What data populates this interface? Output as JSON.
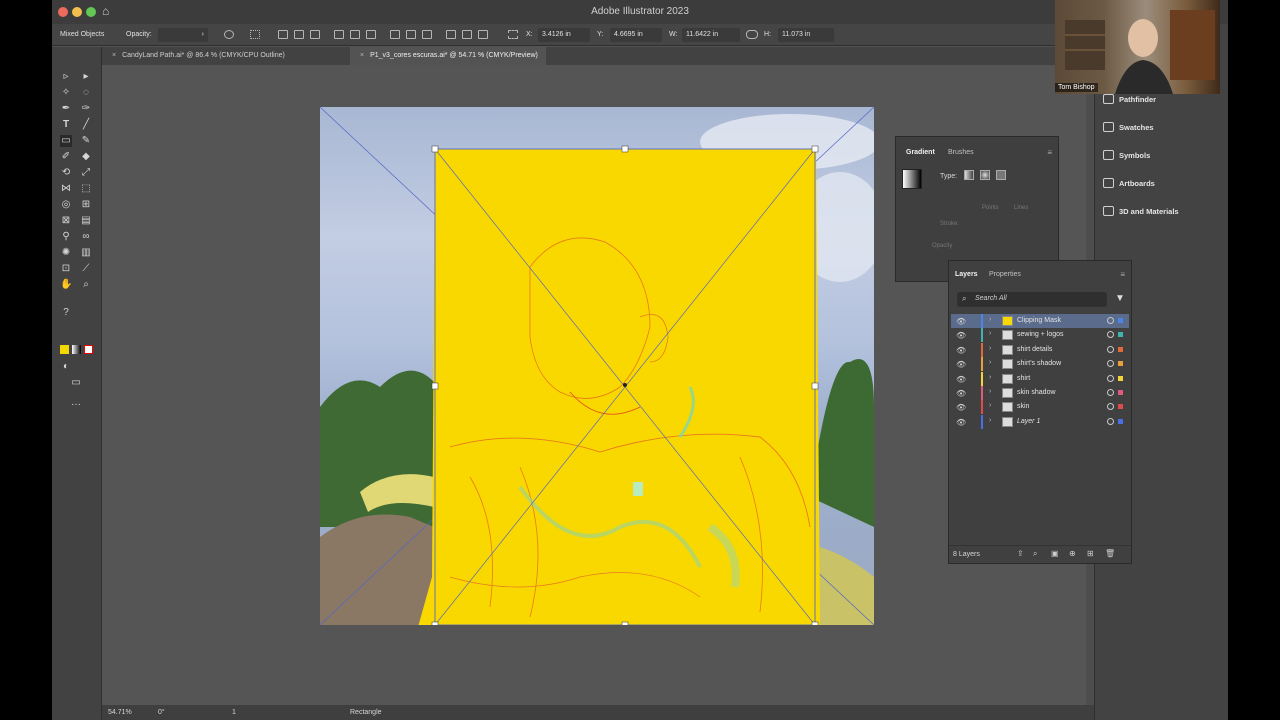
{
  "window": {
    "title": "Adobe Illustrator 2023"
  },
  "control_bar": {
    "selection_type": "Mixed Objects",
    "opacity_label": "Opacity:",
    "x_label": "X:",
    "x_value": "3.4126 in",
    "y_label": "Y:",
    "y_value": "4.6695 in",
    "w_label": "W:",
    "w_value": "11.6422 in",
    "h_label": "H:",
    "h_value": "11.073 in"
  },
  "tabs": [
    {
      "label": "CandyLand Path.ai* @ 86.4 % (CMYK/CPU Outline)",
      "active": false
    },
    {
      "label": "P1_v3_cores escuras.ai* @ 54.71 % (CMYK/Preview)",
      "active": true
    }
  ],
  "status_bar": {
    "zoom": "54.71%",
    "rotation": "0°",
    "artboard": "1",
    "tool": "Rectangle"
  },
  "dock": [
    "Pathfinder",
    "Swatches",
    "Symbols",
    "Artboards",
    "3D and Materials"
  ],
  "gradient_panel": {
    "tabs": [
      "Gradient",
      "Brushes"
    ],
    "type_label": "Type:",
    "stroke_label": "Stroke:",
    "points_label": "Points",
    "lines_label": "Lines",
    "opacity_label": "Opacity"
  },
  "layers_panel": {
    "tabs": [
      "Layers",
      "Properties"
    ],
    "search_placeholder": "Search All",
    "count": "8 Layers",
    "layers": [
      {
        "name": "Clipping Mask",
        "color": "#4a86e8",
        "selected": true
      },
      {
        "name": "sewing + logos",
        "color": "#3fb3b0",
        "selected": false
      },
      {
        "name": "shirt details",
        "color": "#e06a3a",
        "selected": false
      },
      {
        "name": "shirt's shadow",
        "color": "#e8a03a",
        "selected": false
      },
      {
        "name": "shirt",
        "color": "#f2d43a",
        "selected": false
      },
      {
        "name": "skin shadow",
        "color": "#e05a7a",
        "selected": false
      },
      {
        "name": "skin",
        "color": "#e04a4a",
        "selected": false
      },
      {
        "name": "Layer 1",
        "color": "#4a6ee8",
        "selected": false
      }
    ]
  },
  "webcam": {
    "participant_name": "Tom Bishop"
  }
}
